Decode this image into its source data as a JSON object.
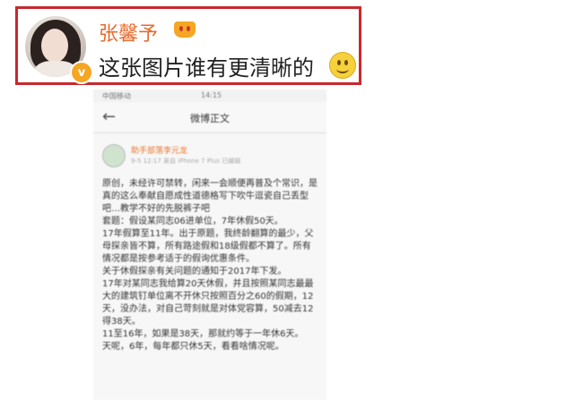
{
  "comment": {
    "username": "张馨予",
    "text": "这张图片谁有更清晰的",
    "badge": "v"
  },
  "phone": {
    "status": {
      "carrier": "中国移动",
      "time": "14:15"
    },
    "nav_title": "微博正文",
    "back_icon": "←",
    "poster": {
      "name": "助手部落李元龙",
      "meta": "9-5 12:17 来自 iPhone 7 Plus  已编辑"
    },
    "paragraphs": [
      "原创，未经许可禁转，闲来一会顺便再普及个常识，是真的这么奉献自愿成性道德格写下吹牛逗瓷自己丢型吧…教学不好的先脱裤子吧",
      "套题：假设某同志06进单位，7年休假50天。",
      "17年假算至11年。出于原题，我终龄翻算的最少，父母探亲皆不算，所有路途假和18级假都不算了。所有情况都是按参考适于的假询优惠条件。",
      "关于休假探亲有关问题的通知于2017年下发。",
      "17年对某同志我给算20天休假，并且按照某同志最最大的建筑钉单位离不开休只按照百分之60的假期，12天，没办法，对自己苛刻就是对体党容算，50减去12得38天。",
      "11至16年，如果是38天，那就约等于一年休6天。",
      "天呢，6年，每年都只休5天，看看啥情况呢。"
    ]
  }
}
